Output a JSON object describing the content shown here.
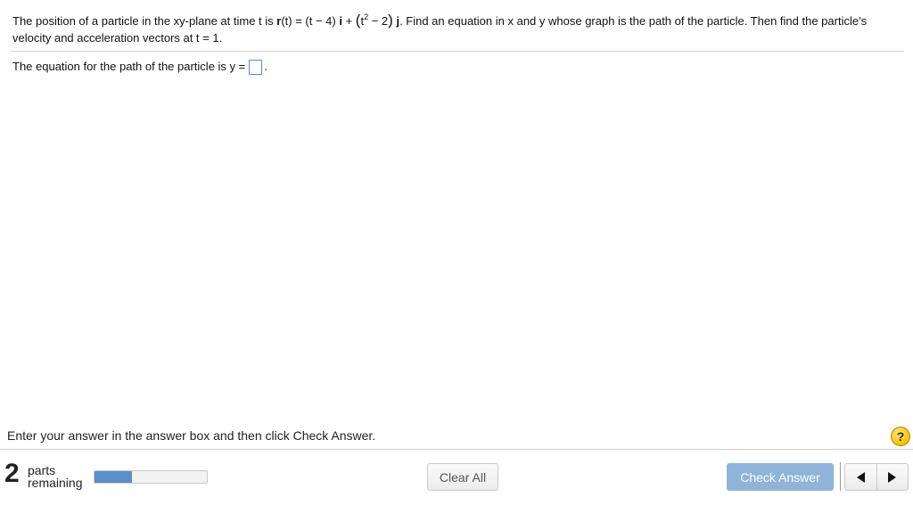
{
  "question": {
    "part1": "The position of a particle in the xy-plane at time t is ",
    "r_symbol": "r",
    "r_args": "(t) = (t − 4) ",
    "i_symbol": "i",
    "plus": " + ",
    "paren_open": "(",
    "t_base": "t",
    "t_exp": "2",
    "minus_two": " − 2",
    "paren_close": ")",
    "j_symbol": " j",
    "part2": ". Find an equation in x and y whose graph is the path of the particle. Then find the particle's velocity and acceleration vectors at t = 1."
  },
  "answer": {
    "prompt": "The equation for the path of the particle is y =",
    "trailing": ".",
    "value": ""
  },
  "instruction": "Enter your answer in the answer box and then click Check Answer.",
  "help_icon": {
    "icon": "question-icon",
    "glyph": "?"
  },
  "parts": {
    "count": "2",
    "label_line1": "parts",
    "label_line2": "remaining",
    "progress_fraction": 0.33
  },
  "buttons": {
    "clear_all": "Clear All",
    "check_answer": "Check Answer"
  },
  "nav": {
    "prev_icon": "triangle-left-icon",
    "next_icon": "triangle-right-icon"
  },
  "colors": {
    "progress_fill": "#5b8fc9",
    "check_button": "#8fb3d9",
    "help_icon": "#f5c200",
    "answer_box_border": "#4a90d9"
  }
}
